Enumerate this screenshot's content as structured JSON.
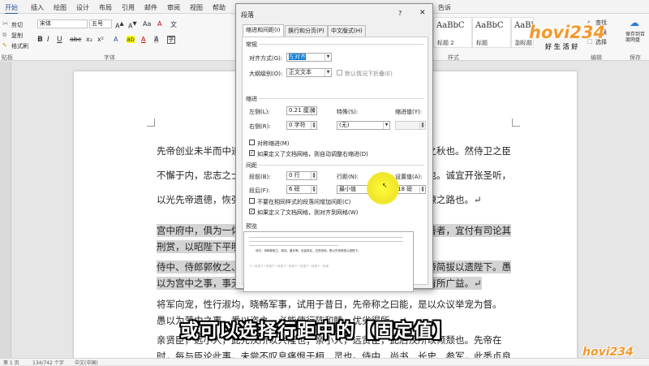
{
  "ribbon_tabs": [
    "开始",
    "插入",
    "绘图",
    "设计",
    "布局",
    "引用",
    "邮件",
    "审阅",
    "视图",
    "帮助",
    "告诉"
  ],
  "clipboard": {
    "cut": "剪切",
    "copy": "复制",
    "format_painter": "格式刷",
    "group": "贴板"
  },
  "font": {
    "name": "宋体",
    "size": "五号",
    "group": "字体"
  },
  "styles": {
    "items": [
      {
        "preview": "AaBbC",
        "name": "标题 2"
      },
      {
        "preview": "AaBbC",
        "name": "标题"
      },
      {
        "preview": "AaBbC",
        "name": "副标题"
      }
    ],
    "group": "样式"
  },
  "editing": {
    "find": "查找",
    "replace": "替换",
    "select": "选择",
    "group": "编辑"
  },
  "save": {
    "label": "保存到百度网盘",
    "group": "保存"
  },
  "logo": {
    "text": "hovi234",
    "slogan": "好 生 活 好"
  },
  "document": {
    "lines": [
      "先帝创业未半而中道崩殂，今天下三分，益州疲弊，此诚危急存亡之秋也。然侍卫之臣",
      "不懈于内，忠志之士忘身于外者，盖追先帝之殊遇，欲报之于陛下也。诚宜开张圣听，",
      "以光先帝遗德，恢弘志士之气，不宜妄自菲薄，引喻失义，以塞忠谏之路也。↵",
      "宫中府中，俱为一体，陟罚臧否，不宜异同。若有作奸犯科及为忠善者，宜付有司论其",
      "刑赏，以昭陛下平明之理，不宜偏私，使内外异法也。↵",
      "侍中、侍郎郭攸之、费祎、董允等，此皆良实，志虑忠纯，是以先帝简拔以遗陛下。愚",
      "以为宫中之事，事无大小，悉以咨之，然后施行，必能裨补阙漏，有所广益。↵",
      "将军向宠，性行淑均，晓畅军事，试用于昔日，先帝称之曰能，是以众议举宠为督。",
      "愚以为营中之事，悉以咨之，必能使行阵和睦，优劣得所。↵",
      "亲贤臣，远小人，此先汉所以兴隆也；亲小人，远贤臣，此后汉所以倾颓也。先帝在",
      "时，每与臣论此事，未尝不叹息痛恨于桓、灵也。侍中、尚书、长史、参军，此悉贞良"
    ]
  },
  "status": {
    "page": "第 1 页",
    "words": "134/742 个字",
    "lang": "中文(中国)"
  },
  "dialog": {
    "title": "段落",
    "help": "?",
    "close": "✕",
    "tabs": [
      "缩进和间距(I)",
      "换行和分页(P)",
      "中文版式(H)"
    ],
    "general": {
      "header": "常规",
      "align_label": "对齐方式(G):",
      "align_value": "左对齐",
      "outline_label": "大纲级别(O):",
      "outline_value": "正文文本",
      "collapse_label": "默认情况下折叠(E)"
    },
    "indent": {
      "header": "缩进",
      "left_label": "左侧(L):",
      "left_value": "0.21 厘米",
      "right_label": "右侧(R):",
      "right_value": "0 字符",
      "special_label": "特殊(S):",
      "special_value": "(无)",
      "amount_label": "缩进值(Y):",
      "amount_value": "",
      "mirror_label": "对称缩进(M)",
      "auto_adjust_label": "如果定义了文档网格，则自动调整右缩进(D)",
      "auto_adjust_checked": true
    },
    "spacing": {
      "header": "间距",
      "before_label": "段前(B):",
      "before_value": "0 行",
      "after_label": "段后(F):",
      "after_value": "6 磅",
      "line_label": "行距(N):",
      "line_value": "最小值",
      "at_label": "设置值(A):",
      "at_value": "18 磅",
      "no_space_label": "不要在相同样式的段落间增加间距(C)",
      "snap_label": "如果定义了文档网格，则对齐到网格(W)",
      "snap_checked": true
    },
    "preview": {
      "header": "预览",
      "sample": "侍中、侍郎郭攸之、费祎、董允等，此皆良实，志虑忠纯，是以先帝简拔以遗陛下。",
      "next": "下一段落下一段落下一段落下一段落下一段落下一段落下一段落"
    }
  },
  "subtitle": "或可以选择行距中的【固定值】",
  "colors": {
    "accent": "#2b579a",
    "logo": "#f2992e",
    "highlight": "#d4d4d4"
  }
}
